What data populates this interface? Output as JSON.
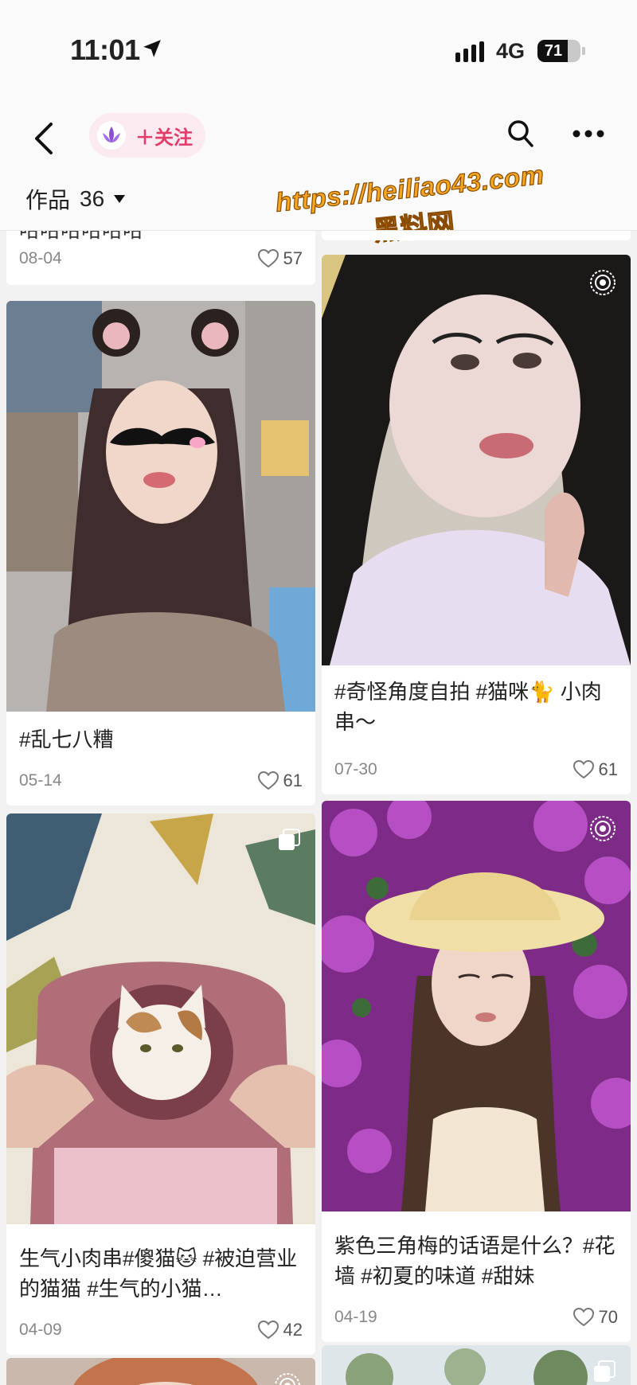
{
  "status_bar": {
    "time": "11:01",
    "network": "4G",
    "battery": "71",
    "battery_level": 0.71
  },
  "header": {
    "follow_label": "＋关注",
    "works_label": "作品",
    "works_count": "36"
  },
  "watermark": {
    "url": "https://heiliao43.com",
    "name": "黑料网"
  },
  "posts": [
    {
      "caption": "哈哈哈哈哈哈",
      "date": "08-04",
      "likes": "57"
    },
    {
      "caption": "",
      "date": "",
      "likes": ""
    },
    {
      "caption": "#乱七八糟",
      "date": "05-14",
      "likes": "61"
    },
    {
      "caption": "#奇怪角度自拍 #猫咪🐈 小肉串～",
      "date": "07-30",
      "likes": "61"
    },
    {
      "caption": "生气小肉串#傻猫🐱 #被迫营业的猫猫 #生气的小猫…",
      "date": "04-09",
      "likes": "42"
    },
    {
      "caption": "紫色三角梅的话语是什么？#花墙 #初夏的味道 #甜妹",
      "date": "04-19",
      "likes": "70"
    }
  ],
  "colors": {
    "accent": "#e23c6a",
    "follow_bg": "#fbeaf0",
    "watermark": "#f5a623"
  }
}
